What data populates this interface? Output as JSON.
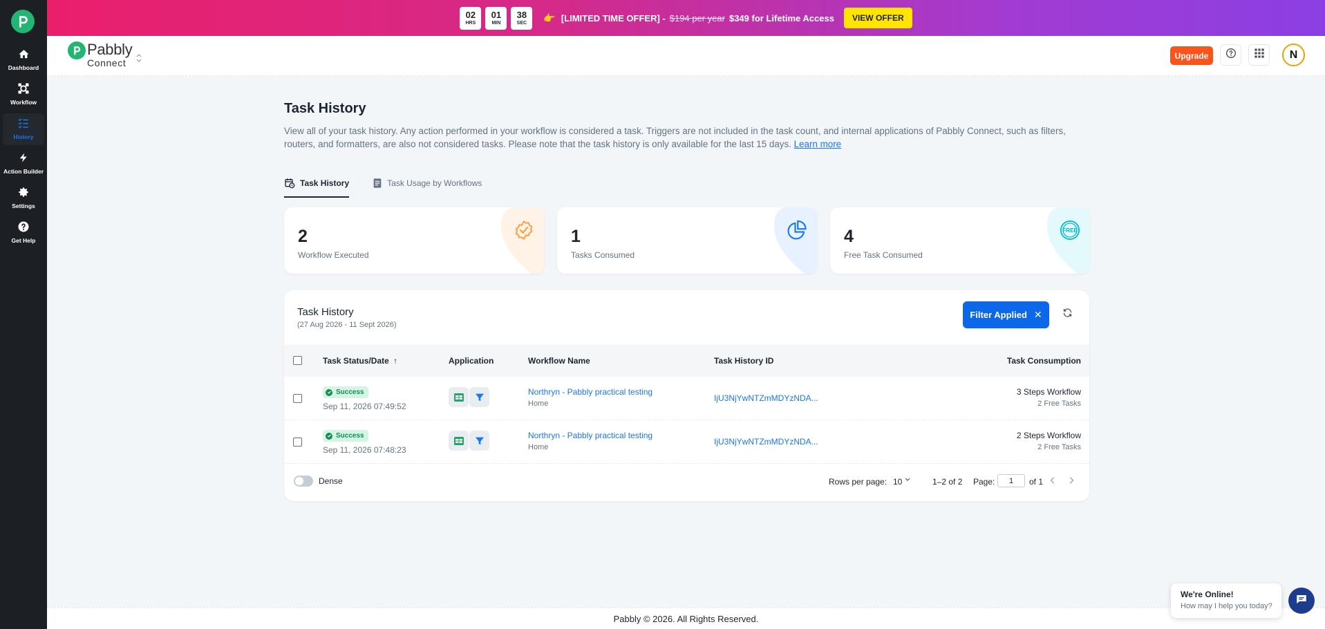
{
  "sidebar": {
    "items": [
      {
        "label": "Dashboard",
        "icon": "home-icon"
      },
      {
        "label": "Workflow",
        "icon": "workflow-icon"
      },
      {
        "label": "History",
        "icon": "history-list-icon"
      },
      {
        "label": "Action Builder",
        "icon": "bolt-icon"
      },
      {
        "label": "Settings",
        "icon": "gear-icon"
      },
      {
        "label": "Get Help",
        "icon": "help-circle-icon"
      }
    ]
  },
  "promo": {
    "countdown": [
      {
        "value": "02",
        "unit": "HRS"
      },
      {
        "value": "01",
        "unit": "MIN"
      },
      {
        "value": "38",
        "unit": "SEC"
      }
    ],
    "hand": "👉",
    "offer_text": "[LIMITED TIME OFFER] -",
    "old_price": "$194 per year",
    "new_price": "$349 for Lifetime Access",
    "button_label": "VIEW OFFER"
  },
  "header": {
    "brand_name": "Pabbly",
    "brand_product": "Connect",
    "upgrade_label": "Upgrade",
    "avatar_initial": "N"
  },
  "page": {
    "title": "Task History",
    "description": "View all of your task history. Any action performed in your workflow is considered a task. Triggers are not included in the task count, and internal applications of Pabbly Connect, such as filters, routers, and formatters, are also not considered tasks. Please note that the task history is only available for the last 15 days.",
    "learn_more": "Learn more",
    "tabs": [
      {
        "label": "Task History"
      },
      {
        "label": "Task Usage by Workflows"
      }
    ]
  },
  "stats": [
    {
      "value": "2",
      "label": "Workflow Executed",
      "accent": "#ff9e3d"
    },
    {
      "value": "1",
      "label": "Tasks Consumed",
      "accent": "#1877f2"
    },
    {
      "value": "4",
      "label": "Free Task Consumed",
      "accent": "#00b8d9"
    }
  ],
  "table": {
    "title": "Task History",
    "range": "(27 Aug 2026 - 11 Sept 2026)",
    "filter_label": "Filter Applied",
    "columns": [
      "Task Status/Date",
      "Application",
      "Workflow Name",
      "Task History ID",
      "Task Consumption"
    ],
    "rows": [
      {
        "status": "Success",
        "date": "Sep 11, 2026 07:49:52",
        "workflow": "Northryn - Pabbly practical testing",
        "folder": "Home",
        "task_id": "IjU3NjYwNTZmMDYzNDA...",
        "consumption": "3 Steps Workflow",
        "free": "2 Free Tasks"
      },
      {
        "status": "Success",
        "date": "Sep 11, 2026 07:48:23",
        "workflow": "Northryn - Pabbly practical testing",
        "folder": "Home",
        "task_id": "IjU3NjYwNTZmMDYzNDA...",
        "consumption": "2 Steps Workflow",
        "free": "2 Free Tasks"
      }
    ],
    "dense_label": "Dense",
    "rows_per_page_label": "Rows per page:",
    "rows_per_page": "10",
    "range_text": "1–2 of 2",
    "page_label": "Page:",
    "page_value": "1",
    "of_label": "of 1"
  },
  "footer": {
    "copyright": "Pabbly © 2026. All Rights Reserved."
  },
  "chat": {
    "title": "We're Online!",
    "subtitle": "How may I help you today?"
  }
}
